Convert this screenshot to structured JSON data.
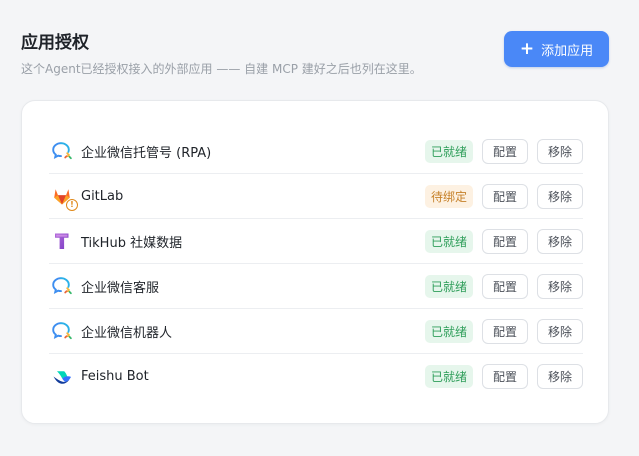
{
  "header": {
    "title": "应用授权",
    "subtitle": "这个Agent已经授权接入的外部应用 —— 自建 MCP 建好之后也列在这里。",
    "add_button_label": "添加应用"
  },
  "apps": [
    {
      "name": "企业微信托管号 (RPA)",
      "icon": "wecom-chat-icon",
      "status": "已就绪",
      "status_kind": "ok",
      "config_label": "配置",
      "remove_label": "移除"
    },
    {
      "name": "GitLab",
      "icon": "gitlab-icon",
      "status": "待绑定",
      "status_kind": "wait",
      "config_label": "配置",
      "remove_label": "移除"
    },
    {
      "name": "TikHub 社媒数据",
      "icon": "tikhub-icon",
      "status": "已就绪",
      "status_kind": "ok",
      "config_label": "配置",
      "remove_label": "移除"
    },
    {
      "name": "企业微信客服",
      "icon": "wecom-chat-icon",
      "status": "已就绪",
      "status_kind": "ok",
      "config_label": "配置",
      "remove_label": "移除"
    },
    {
      "name": "企业微信机器人",
      "icon": "wecom-chat-icon",
      "status": "已就绪",
      "status_kind": "ok",
      "config_label": "配置",
      "remove_label": "移除"
    },
    {
      "name": "Feishu Bot",
      "icon": "feishu-icon",
      "status": "已就绪",
      "status_kind": "ok",
      "config_label": "配置",
      "remove_label": "移除"
    }
  ],
  "colors": {
    "accent": "#4a88f7",
    "ready_bg": "#e6f6ec",
    "ready_text": "#2f9e5a",
    "pending_bg": "#fdf1e2",
    "pending_text": "#c6812a"
  }
}
